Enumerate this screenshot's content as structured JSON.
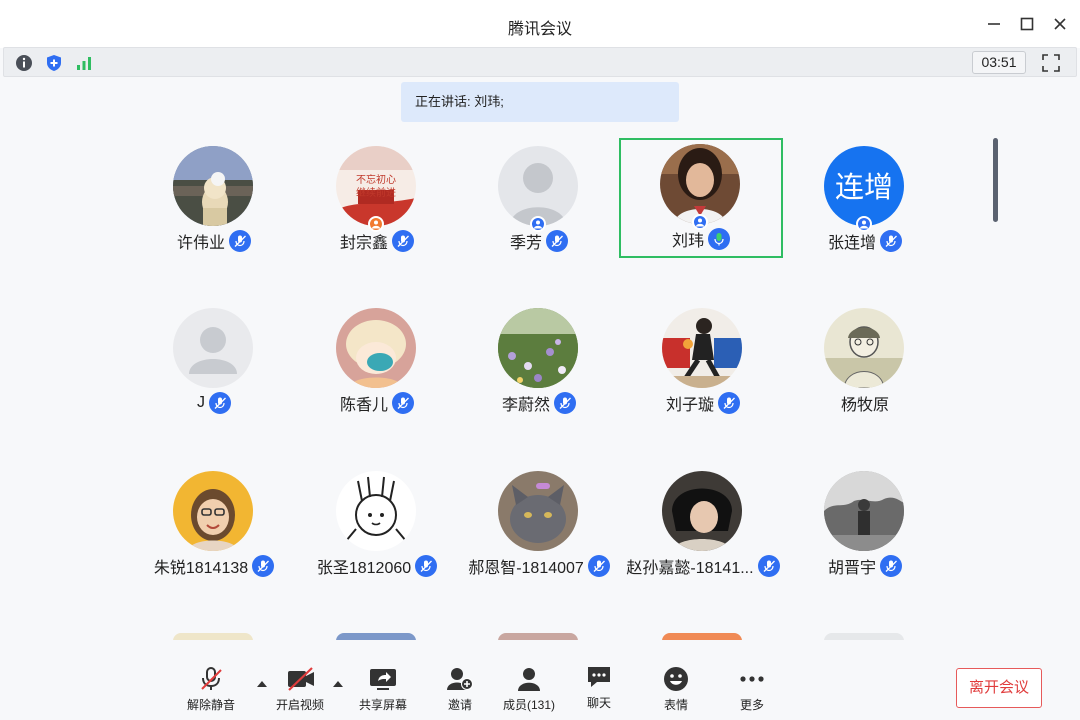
{
  "window": {
    "title": "腾讯会议"
  },
  "infobar": {
    "timer": "03:51"
  },
  "speaking": {
    "text": "正在讲话: 刘玮;"
  },
  "participants": [
    {
      "name": "许伟业",
      "avatar_text": "",
      "mic": "muted"
    },
    {
      "name": "封宗鑫",
      "avatar_text": "不忘初心 继续前进",
      "mic": "muted",
      "host": "co-host"
    },
    {
      "name": "季芳",
      "avatar_text": "",
      "mic": "muted",
      "host": "host"
    },
    {
      "name": "刘玮",
      "avatar_text": "",
      "mic": "speaking",
      "host": "host",
      "active": true
    },
    {
      "name": "张连增",
      "avatar_text": "连增",
      "mic": "muted",
      "host": "host"
    },
    {
      "name": "J",
      "avatar_text": "",
      "mic": "muted"
    },
    {
      "name": "陈香儿",
      "avatar_text": "",
      "mic": "muted"
    },
    {
      "name": "李蔚然",
      "avatar_text": "",
      "mic": "muted"
    },
    {
      "name": "刘子璇",
      "avatar_text": "",
      "mic": "muted"
    },
    {
      "name": "杨牧原",
      "avatar_text": "",
      "mic": "none"
    },
    {
      "name": "朱锐1814138",
      "avatar_text": "",
      "mic": "muted"
    },
    {
      "name": "张圣1812060",
      "avatar_text": "",
      "mic": "muted"
    },
    {
      "name": "郝恩智-1814007",
      "avatar_text": "",
      "mic": "muted"
    },
    {
      "name": "赵孙嘉懿-18141...",
      "avatar_text": "",
      "mic": "muted"
    },
    {
      "name": "胡晋宇",
      "avatar_text": "",
      "mic": "muted"
    }
  ],
  "toolbar": {
    "unmute": "解除静音",
    "start_video": "开启视频",
    "share_screen": "共享屏幕",
    "invite": "邀请",
    "members": "成员(131)",
    "chat": "聊天",
    "reactions": "表情",
    "more": "更多",
    "leave": "离开会议"
  },
  "colors": {
    "accent": "#2f6ef2",
    "speaking_border": "#2fbd62",
    "leave": "#e03c3c",
    "banner": "#dde9fb"
  }
}
